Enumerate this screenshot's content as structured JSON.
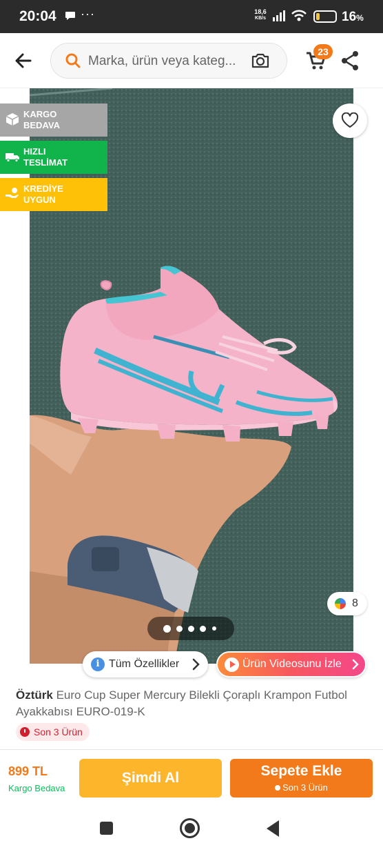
{
  "status_bar": {
    "time": "20:04",
    "extra": "···",
    "net_speed_value": "18,6",
    "net_speed_unit": "KB/s",
    "battery_percent": "16",
    "battery_suffix": "%"
  },
  "header": {
    "search_placeholder": "Marka, ürün veya kateg...",
    "cart_count": "23",
    "icons": [
      "back-arrow-icon",
      "search-icon",
      "camera-icon",
      "cart-icon",
      "share-icon"
    ]
  },
  "image": {
    "badges": [
      {
        "line1": "KARGO",
        "line2": "BEDAVA",
        "icon": "box-icon",
        "color": "#a6a6a6"
      },
      {
        "line1": "HIZLI",
        "line2": "TESLİMAT",
        "icon": "truck-icon",
        "color": "#10b44b"
      },
      {
        "line1": "KREDİYE",
        "line2": "UYGUN",
        "icon": "hand-coin-icon",
        "color": "#ffc107"
      }
    ],
    "color_variant_count": "8",
    "carousel_total_dots": 5,
    "carousel_active_index": 0,
    "features_button": "Tüm Özellikler",
    "video_button": "Ürün Videosunu İzle"
  },
  "product": {
    "brand": "Öztürk",
    "title": "Euro Cup Super Mercury Bilekli Çoraplı Krampon Futbol Ayakkabısı EURO-019-K",
    "stock_label": "Son 3 Ürün"
  },
  "bottom_bar": {
    "price": "899 TL",
    "shipping": "Kargo Bedava",
    "buy_now": "Şimdi Al",
    "add_to_cart": "Sepete Ekle",
    "add_to_cart_sub": "Son 3 Ürün"
  },
  "colors": {
    "brand_orange": "#f27a1a",
    "buy_yellow": "#fdb62b",
    "stock_red": "#d21f2e",
    "ship_green": "#0bc15c"
  }
}
